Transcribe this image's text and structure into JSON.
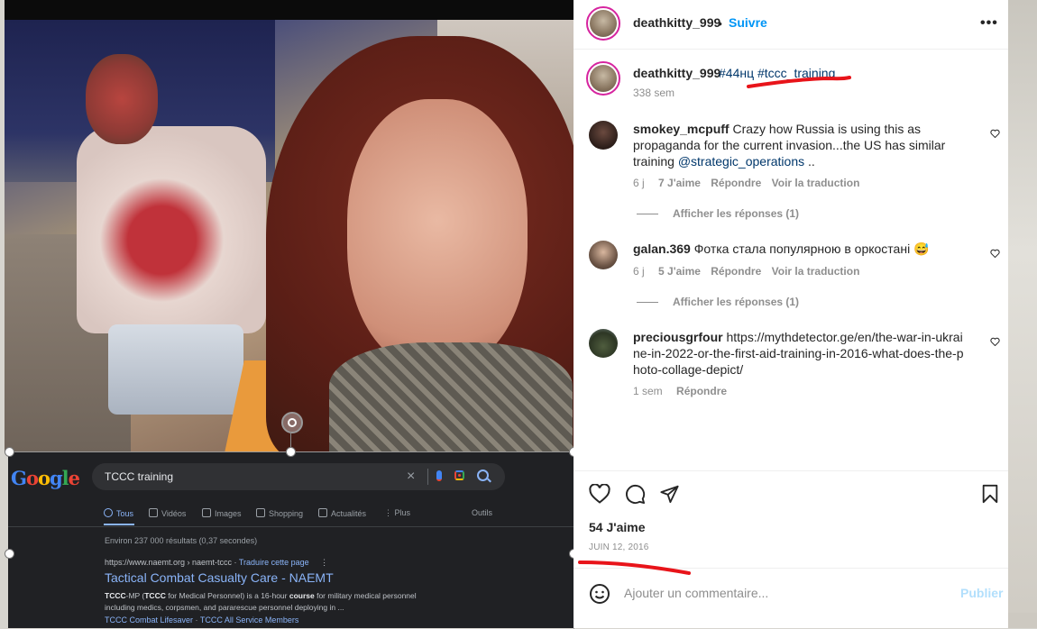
{
  "google": {
    "logo": "Google",
    "query": "TCCC training",
    "tabs": [
      {
        "label": "Tous",
        "active": true
      },
      {
        "label": "Vidéos"
      },
      {
        "label": "Images"
      },
      {
        "label": "Shopping"
      },
      {
        "label": "Actualités"
      },
      {
        "label": "Plus"
      }
    ],
    "tools": "Outils",
    "stats": "Environ 237 000 résultats (0,37 secondes)",
    "result": {
      "url": "https://www.naemt.org › naemt-tccc",
      "translate": "Traduire cette page",
      "title": "Tactical Combat Casualty Care - NAEMT",
      "snippet_1a": "TCCC",
      "snippet_1b": "-MP (",
      "snippet_1c": "TCCC",
      "snippet_1d": " for Medical Personnel) is a 16-hour ",
      "snippet_1e": "course",
      "snippet_1f": " for military medical personnel",
      "snippet_2": "including medics, corpsmen, and pararescue personnel deploying in ...",
      "link_1": "TCCC Combat Lifesaver",
      "link_sep": "·",
      "link_2": "TCCC All Service Members"
    }
  },
  "post": {
    "username": "deathkitty_999",
    "separator": "•",
    "follow": "Suivre",
    "caption_tags": "#44нц #tccc_training",
    "caption_age": "338 sem",
    "comments": [
      {
        "user": "smokey_mcpuff",
        "text": "Crazy how Russia is using this as propaganda for the current invasion...the US has similar training",
        "mention": "@strategic_operations",
        "tail": " ..",
        "age": "6 j",
        "likes": "7 J'aime",
        "reply": "Répondre",
        "translate": "Voir la traduction",
        "replies": "Afficher les réponses (1)"
      },
      {
        "user": "galan.369",
        "text": "Фотка стала популярною в оркостані 😅",
        "age": "6 j",
        "likes": "5 J'aime",
        "reply": "Répondre",
        "translate": "Voir la traduction",
        "replies": "Afficher les réponses (1)"
      },
      {
        "user": "preciousgrfour",
        "text": "https://mythdetector.ge/en/the-war-in-ukraine-in-2022-or-the-first-aid-training-in-2016-what-does-the-photo-collage-depict/",
        "age": "1 sem",
        "reply": "Répondre"
      }
    ],
    "likes": "54 J'aime",
    "date": "JUIN 12, 2016",
    "add_comment_placeholder": "Ajouter un commentaire...",
    "publish": "Publier"
  },
  "colors": {
    "instagram_blue": "#0095f6",
    "annotation_red": "#e8141a",
    "google_dark_bg": "#202124",
    "google_link": "#8ab4f8"
  }
}
